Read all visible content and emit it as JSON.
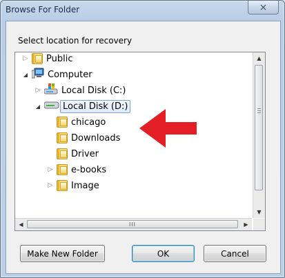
{
  "window": {
    "title": "Browse For Folder",
    "close_label": "⨯"
  },
  "dialog": {
    "prompt": "Select location for recovery"
  },
  "tree": {
    "items": [
      {
        "label": "Public",
        "expander": "▷"
      },
      {
        "label": "Computer",
        "expander": "◢"
      },
      {
        "label": "Local Disk (C:)",
        "expander": "▷"
      },
      {
        "label": "Local Disk (D:)",
        "expander": "◢"
      },
      {
        "label": "chicago",
        "expander": ""
      },
      {
        "label": "Downloads",
        "expander": ""
      },
      {
        "label": "Driver",
        "expander": ""
      },
      {
        "label": "e-books",
        "expander": "▷"
      },
      {
        "label": "Image",
        "expander": "▷"
      }
    ],
    "hscroll_grip": "III"
  },
  "buttons": {
    "make_new_folder": "Make New Folder",
    "ok": "OK",
    "cancel": "Cancel"
  },
  "annotation": {
    "arrow_color": "#e31e24"
  }
}
